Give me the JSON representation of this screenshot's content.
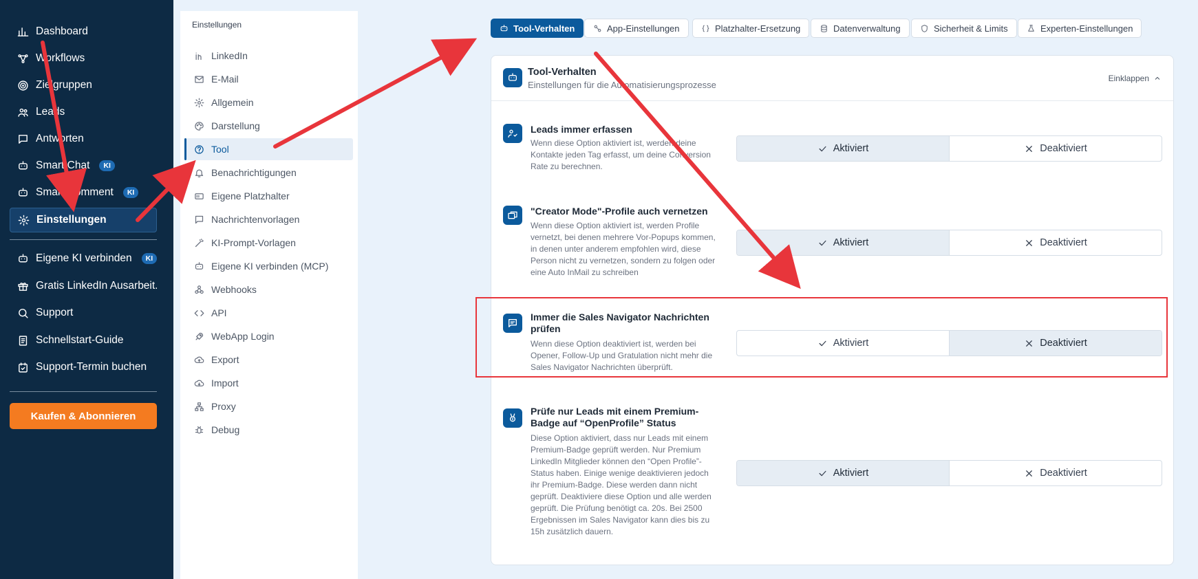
{
  "sidebar": {
    "items": [
      {
        "label": "Dashboard",
        "icon": "chart-icon"
      },
      {
        "label": "Workflows",
        "icon": "workflow-icon"
      },
      {
        "label": "Zielgruppen",
        "icon": "target-icon"
      },
      {
        "label": "Leads",
        "icon": "users-icon"
      },
      {
        "label": "Antworten",
        "icon": "chat-icon"
      },
      {
        "label": "Smart Chat",
        "icon": "robot-icon",
        "badge": "KI"
      },
      {
        "label": "Smart Comment",
        "icon": "robot-icon",
        "badge": "KI"
      },
      {
        "label": "Einstellungen",
        "icon": "gear-icon",
        "active": true
      }
    ],
    "items2": [
      {
        "label": "Eigene KI verbinden",
        "icon": "robot-icon",
        "badge": "KI"
      },
      {
        "label": "Gratis LinkedIn Ausarbeit...",
        "icon": "gift-icon"
      },
      {
        "label": "Support",
        "icon": "support-icon"
      },
      {
        "label": "Schnellstart-Guide",
        "icon": "book-icon"
      },
      {
        "label": "Support-Termin buchen",
        "icon": "calendar-icon"
      }
    ],
    "buy_label": "Kaufen & Abonnieren"
  },
  "submenu": {
    "title": "Einstellungen",
    "items": [
      {
        "label": "LinkedIn",
        "icon": "linkedin-icon"
      },
      {
        "label": "E-Mail",
        "icon": "mail-icon"
      },
      {
        "label": "Allgemein",
        "icon": "gear-icon"
      },
      {
        "label": "Darstellung",
        "icon": "palette-icon"
      },
      {
        "label": "Tool",
        "icon": "tool-icon",
        "active": true
      },
      {
        "label": "Benachrichtigungen",
        "icon": "bell-icon"
      },
      {
        "label": "Eigene Platzhalter",
        "icon": "placeholder-icon"
      },
      {
        "label": "Nachrichtenvorlagen",
        "icon": "message-icon"
      },
      {
        "label": "KI-Prompt-Vorlagen",
        "icon": "wand-icon"
      },
      {
        "label": "Eigene KI verbinden (MCP)",
        "icon": "robot-icon"
      },
      {
        "label": "Webhooks",
        "icon": "webhook-icon"
      },
      {
        "label": "API",
        "icon": "code-icon"
      },
      {
        "label": "WebApp Login",
        "icon": "rocket-icon"
      },
      {
        "label": "Export",
        "icon": "cloud-upload-icon"
      },
      {
        "label": "Import",
        "icon": "cloud-download-icon"
      },
      {
        "label": "Proxy",
        "icon": "network-icon"
      },
      {
        "label": "Debug",
        "icon": "bug-icon"
      }
    ]
  },
  "tabs": [
    {
      "label": "Tool-Verhalten",
      "active": true
    },
    {
      "label": "App-Einstellungen"
    },
    {
      "label": "Platzhalter-Ersetzung"
    },
    {
      "label": "Datenverwaltung"
    },
    {
      "label": "Sicherheit & Limits"
    },
    {
      "label": "Experten-Einstellungen"
    }
  ],
  "card": {
    "title": "Tool-Verhalten",
    "subtitle": "Einstellungen für die Automatisierungsprozesse",
    "collapse_label": "Einklappen"
  },
  "options": [
    {
      "title": "Leads immer erfassen",
      "description": "Wenn diese Option aktiviert ist, werden deine Kontakte jeden Tag erfasst, um deine Conversion Rate zu berechnen.",
      "selected": "Aktiviert"
    },
    {
      "title": "\"Creator Mode\"-Profile auch vernetzen",
      "description": "Wenn diese Option aktiviert ist, werden Profile vernetzt, bei denen mehrere Vor-Popups kommen, in denen unter anderem empfohlen wird, diese Person nicht zu vernetzen, sondern zu folgen oder eine Auto InMail zu schreiben",
      "selected": "Aktiviert"
    },
    {
      "title": "Immer die Sales Navigator Nachrichten prüfen",
      "description": "Wenn diese Option deaktiviert ist, werden bei Opener, Follow-Up und Gratulation nicht mehr die Sales Navigator Nachrichten überprüft.",
      "selected": "Deaktiviert"
    },
    {
      "title": "Prüfe nur Leads mit einem Premium-Badge auf “OpenProfile” Status",
      "description": "Diese Option aktiviert, dass nur Leads mit einem Premium-Badge geprüft werden. Nur Premium LinkedIn Mitglieder können den “Open Profile”-Status haben. Einige wenige deaktivieren jedoch ihr Premium-Badge. Diese werden dann nicht geprüft. Deaktiviere diese Option und alle werden geprüft. Die Prüfung benötigt ca. 20s. Bei 2500 Ergebnissen im Sales Navigator kann dies bis zu 15h zusätzlich dauern.",
      "selected": "Aktiviert"
    }
  ],
  "toggle_labels": {
    "on": "Aktiviert",
    "off": "Deaktiviert"
  },
  "colors": {
    "sidebar_bg": "#0d2a44",
    "primary": "#0b5a9c",
    "buy_button": "#f47b20",
    "annotation": "#e8353b"
  }
}
